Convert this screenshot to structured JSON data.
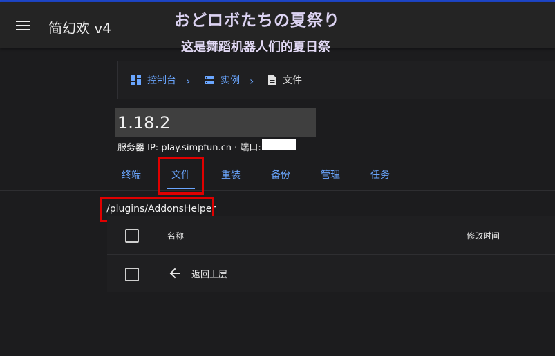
{
  "app": {
    "title": "简幻欢 v4",
    "overlay_line1": "おどロボたちの夏祭り",
    "overlay_line2": "这是舞蹈机器人们的夏日祭"
  },
  "breadcrumb": {
    "items": [
      {
        "label": "控制台",
        "icon": "dashboard-icon"
      },
      {
        "label": "实例",
        "icon": "server-icon"
      },
      {
        "label": "文件",
        "icon": "file-icon"
      }
    ],
    "separator": "chevron-right-icon"
  },
  "instance": {
    "name": "1.18.2",
    "server_info": "服务器 IP: play.simpfun.cn · 端口:"
  },
  "tabs": [
    {
      "label": "终端"
    },
    {
      "label": "文件",
      "active": true
    },
    {
      "label": "重装"
    },
    {
      "label": "备份"
    },
    {
      "label": "管理"
    },
    {
      "label": "任务"
    }
  ],
  "files": {
    "current_path": "/plugins/AddonsHelper",
    "columns": {
      "name": "名称",
      "modified": "修改时间"
    },
    "rows": [
      {
        "label": "返回上层",
        "icon": "arrow-left-icon"
      }
    ]
  },
  "colors": {
    "accent": "#6aa6ff",
    "highlight_box": "#e00000",
    "background": "#1c1c1e"
  }
}
